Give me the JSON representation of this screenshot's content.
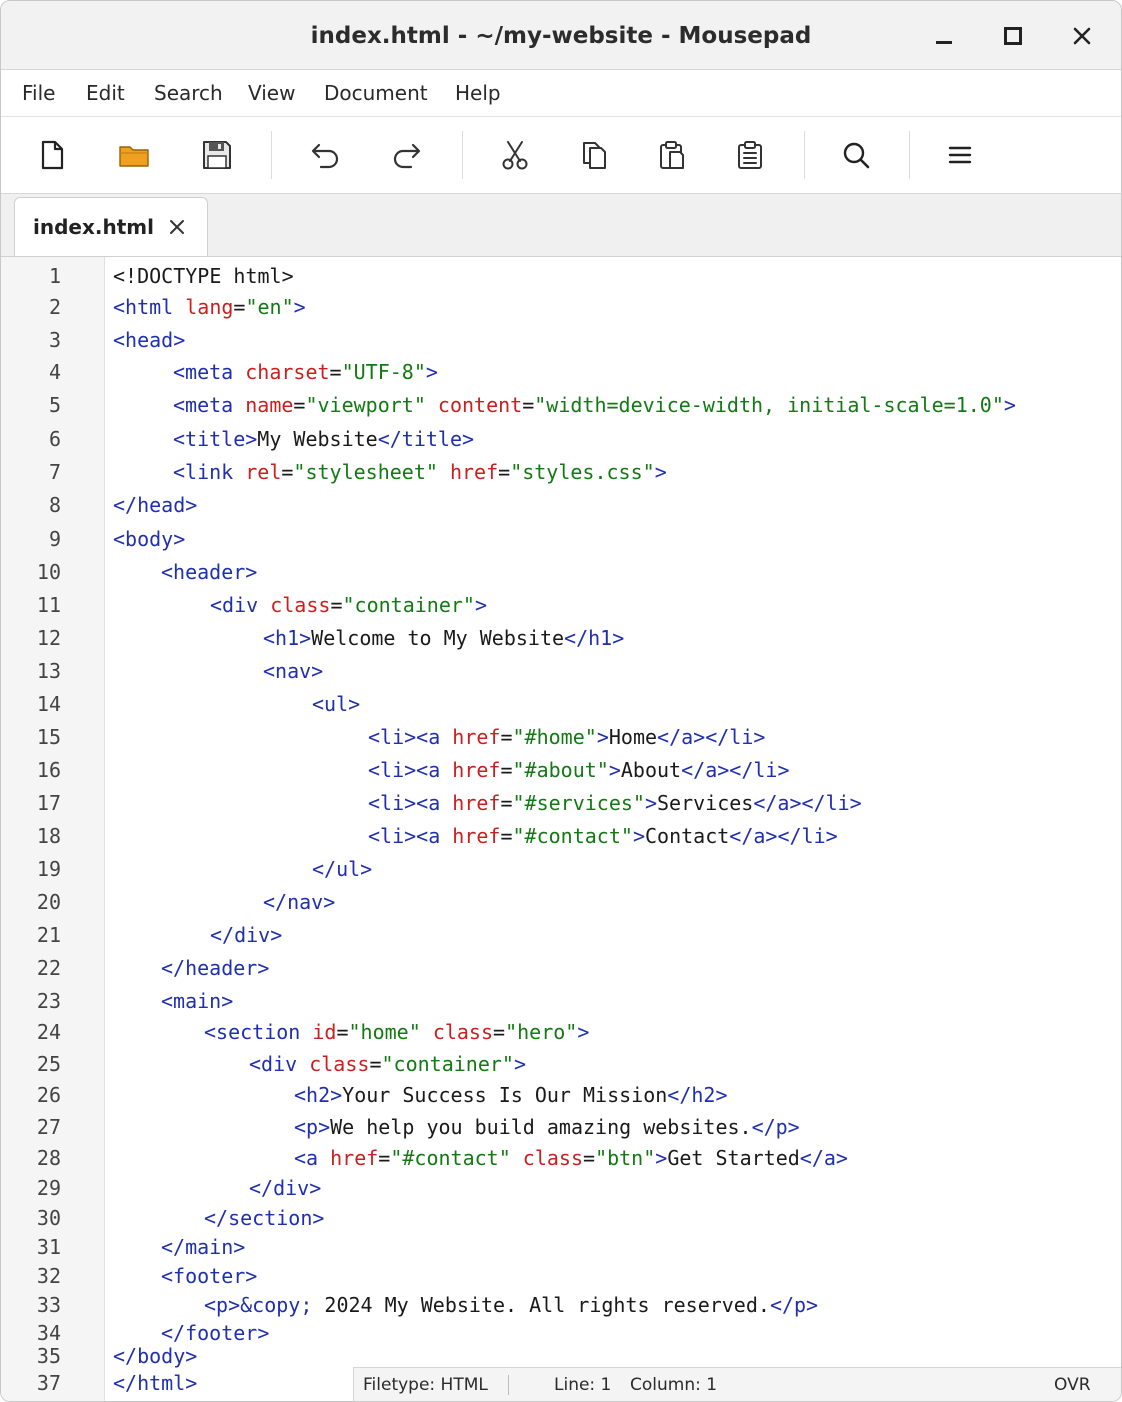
{
  "window": {
    "title": "index.html - ~/my-website - Mousepad"
  },
  "menu": [
    "File",
    "Edit",
    "Search",
    "View",
    "Document",
    "Help"
  ],
  "toolbar": {
    "icons": [
      "new-document-icon",
      "open-folder-icon",
      "save-icon",
      "undo-icon",
      "redo-icon",
      "cut-icon",
      "copy-icon",
      "paste-icon",
      "clipboard-icon",
      "search-icon",
      "hamburger-menu-icon"
    ]
  },
  "tabs": [
    {
      "label": "index.html",
      "active": true
    }
  ],
  "editor": {
    "lines": [
      {
        "n": "1",
        "indent": 0,
        "tokens": [
          [
            "x",
            "<!DOCTYPE html>"
          ]
        ]
      },
      {
        "n": "2",
        "indent": 0,
        "tokens": [
          [
            "t",
            "<html "
          ],
          [
            "a",
            "lang"
          ],
          [
            "x",
            "="
          ],
          [
            "s",
            "\"en\""
          ],
          [
            "t",
            ">"
          ]
        ]
      },
      {
        "n": "3",
        "indent": 0,
        "tokens": [
          [
            "t",
            "<head>"
          ]
        ]
      },
      {
        "n": "4",
        "indent": 60,
        "tokens": [
          [
            "t",
            "<meta "
          ],
          [
            "a",
            "charset"
          ],
          [
            "x",
            "="
          ],
          [
            "s",
            "\"UTF-8\""
          ],
          [
            "t",
            ">"
          ]
        ]
      },
      {
        "n": "5",
        "indent": 60,
        "tokens": [
          [
            "t",
            "<meta "
          ],
          [
            "a",
            "name"
          ],
          [
            "x",
            "="
          ],
          [
            "s",
            "\"viewport\" "
          ],
          [
            "a",
            "content"
          ],
          [
            "x",
            "="
          ],
          [
            "s",
            "\"width=device-width, initial-scale=1.0\""
          ],
          [
            "t",
            ">"
          ]
        ]
      },
      {
        "n": "6",
        "indent": 60,
        "tokens": [
          [
            "t",
            "<title>"
          ],
          [
            "x",
            "My Website"
          ],
          [
            "t",
            "</title>"
          ]
        ]
      },
      {
        "n": "7",
        "indent": 60,
        "tokens": [
          [
            "t",
            "<link "
          ],
          [
            "a",
            "rel"
          ],
          [
            "x",
            "="
          ],
          [
            "s",
            "\"stylesheet\" "
          ],
          [
            "a",
            "href"
          ],
          [
            "x",
            "="
          ],
          [
            "s",
            "\"styles.css\""
          ],
          [
            "t",
            ">"
          ]
        ]
      },
      {
        "n": "8",
        "indent": 0,
        "tokens": [
          [
            "t",
            "</head>"
          ]
        ]
      },
      {
        "n": "9",
        "indent": 0,
        "tokens": [
          [
            "t",
            "<body>"
          ]
        ]
      },
      {
        "n": "10",
        "indent": 48,
        "tokens": [
          [
            "t",
            "<header>"
          ]
        ]
      },
      {
        "n": "11",
        "indent": 97,
        "tokens": [
          [
            "t",
            "<div "
          ],
          [
            "a",
            "class"
          ],
          [
            "x",
            "="
          ],
          [
            "s",
            "\"container\""
          ],
          [
            "t",
            ">"
          ]
        ]
      },
      {
        "n": "12",
        "indent": 150,
        "tokens": [
          [
            "t",
            "<h1>"
          ],
          [
            "x",
            "Welcome to My Website"
          ],
          [
            "t",
            "</h1>"
          ]
        ]
      },
      {
        "n": "13",
        "indent": 150,
        "tokens": [
          [
            "t",
            "<nav>"
          ]
        ]
      },
      {
        "n": "14",
        "indent": 199,
        "tokens": [
          [
            "t",
            "<ul>"
          ]
        ]
      },
      {
        "n": "15",
        "indent": 255,
        "tokens": [
          [
            "t",
            "<li><a "
          ],
          [
            "a",
            "href"
          ],
          [
            "x",
            "="
          ],
          [
            "s",
            "\"#home\""
          ],
          [
            "t",
            ">"
          ],
          [
            "x",
            "Home"
          ],
          [
            "t",
            "</a></li>"
          ]
        ]
      },
      {
        "n": "16",
        "indent": 255,
        "tokens": [
          [
            "t",
            "<li><a "
          ],
          [
            "a",
            "href"
          ],
          [
            "x",
            "="
          ],
          [
            "s",
            "\"#about\""
          ],
          [
            "t",
            ">"
          ],
          [
            "x",
            "About"
          ],
          [
            "t",
            "</a></li>"
          ]
        ]
      },
      {
        "n": "17",
        "indent": 255,
        "tokens": [
          [
            "t",
            "<li><a "
          ],
          [
            "a",
            "href"
          ],
          [
            "x",
            "="
          ],
          [
            "s",
            "\"#services\""
          ],
          [
            "t",
            ">"
          ],
          [
            "x",
            "Services"
          ],
          [
            "t",
            "</a></li>"
          ]
        ]
      },
      {
        "n": "18",
        "indent": 255,
        "tokens": [
          [
            "t",
            "<li><a "
          ],
          [
            "a",
            "href"
          ],
          [
            "x",
            "="
          ],
          [
            "s",
            "\"#contact\""
          ],
          [
            "t",
            ">"
          ],
          [
            "x",
            "Contact"
          ],
          [
            "t",
            "</a></li>"
          ]
        ]
      },
      {
        "n": "19",
        "indent": 199,
        "tokens": [
          [
            "t",
            "</ul>"
          ]
        ]
      },
      {
        "n": "20",
        "indent": 150,
        "tokens": [
          [
            "t",
            "</nav>"
          ]
        ]
      },
      {
        "n": "21",
        "indent": 97,
        "tokens": [
          [
            "t",
            "</div>"
          ]
        ]
      },
      {
        "n": "22",
        "indent": 48,
        "tokens": [
          [
            "t",
            "</header>"
          ]
        ]
      },
      {
        "n": "23",
        "indent": 48,
        "tokens": [
          [
            "t",
            "<main>"
          ]
        ]
      },
      {
        "n": "24",
        "indent": 91,
        "tokens": [
          [
            "t",
            "<section "
          ],
          [
            "a",
            "id"
          ],
          [
            "x",
            "="
          ],
          [
            "s",
            "\"home\" "
          ],
          [
            "a",
            "class"
          ],
          [
            "x",
            "="
          ],
          [
            "s",
            "\"hero\""
          ],
          [
            "t",
            ">"
          ]
        ]
      },
      {
        "n": "25",
        "indent": 136,
        "tokens": [
          [
            "t",
            "<div "
          ],
          [
            "a",
            "class"
          ],
          [
            "x",
            "="
          ],
          [
            "s",
            "\"container\""
          ],
          [
            "t",
            ">"
          ]
        ]
      },
      {
        "n": "26",
        "indent": 181,
        "tokens": [
          [
            "t",
            "<h2>"
          ],
          [
            "x",
            "Your Success Is Our Mission"
          ],
          [
            "t",
            "</h2>"
          ]
        ]
      },
      {
        "n": "27",
        "indent": 181,
        "tokens": [
          [
            "t",
            "<p>"
          ],
          [
            "x",
            "We help you build amazing websites."
          ],
          [
            "t",
            "</p>"
          ]
        ]
      },
      {
        "n": "28",
        "indent": 181,
        "tokens": [
          [
            "t",
            "<a "
          ],
          [
            "a",
            "href"
          ],
          [
            "x",
            "="
          ],
          [
            "s",
            "\"#contact\" "
          ],
          [
            "a",
            "class"
          ],
          [
            "x",
            "="
          ],
          [
            "s",
            "\"btn\""
          ],
          [
            "t",
            ">"
          ],
          [
            "x",
            "Get Started"
          ],
          [
            "t",
            "</a>"
          ]
        ]
      },
      {
        "n": "29",
        "indent": 136,
        "tokens": [
          [
            "t",
            "</div>"
          ]
        ]
      },
      {
        "n": "30",
        "indent": 91,
        "tokens": [
          [
            "t",
            "</section>"
          ]
        ]
      },
      {
        "n": "31",
        "indent": 48,
        "tokens": [
          [
            "t",
            "</main>"
          ]
        ]
      },
      {
        "n": "32",
        "indent": 48,
        "tokens": [
          [
            "t",
            "<footer>"
          ]
        ]
      },
      {
        "n": "33",
        "indent": 91,
        "tokens": [
          [
            "t",
            "<p>&copy;"
          ],
          [
            "x",
            " 2024 My Website. All rights reserved."
          ],
          [
            "t",
            "</p>"
          ]
        ]
      },
      {
        "n": "34",
        "indent": 48,
        "tokens": [
          [
            "t",
            "</footer>"
          ]
        ]
      },
      {
        "n": "35",
        "indent": 0,
        "tokens": [
          [
            "t",
            "</body>"
          ]
        ]
      },
      {
        "n": "37",
        "indent": 0,
        "tokens": [
          [
            "t",
            "</html>"
          ]
        ]
      }
    ]
  },
  "statusbar": {
    "filetype": "Filetype: HTML",
    "line": "Line: 1",
    "column": "Column: 1",
    "mode": "OVR"
  },
  "colors": {
    "tag": "#1f2fb0",
    "attribute": "#cc1e1e",
    "string": "#137a13",
    "text": "#1a1a1a",
    "folder": "#f0a020"
  }
}
